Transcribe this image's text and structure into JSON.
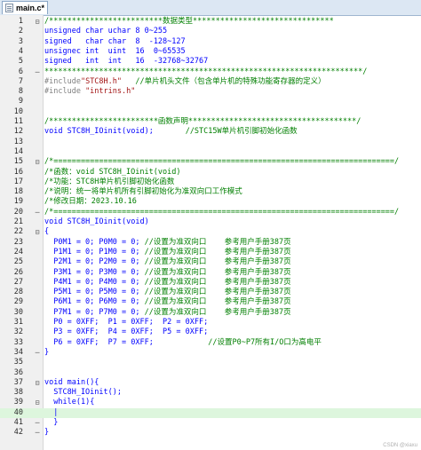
{
  "tab": {
    "title": "main.c*"
  },
  "watermark": "CSDN @xiaxu",
  "lines": [
    {
      "n": "1",
      "fold": "⊟",
      "segs": [
        [
          "cm",
          "/*************************数据类型*******************************"
        ]
      ]
    },
    {
      "n": "2",
      "fold": "",
      "segs": [
        [
          "txt",
          "unsigned char uchar 8 0~255"
        ]
      ]
    },
    {
      "n": "3",
      "fold": "",
      "segs": [
        [
          "txt",
          "signed   char char  8  -128~127"
        ]
      ]
    },
    {
      "n": "4",
      "fold": "",
      "segs": [
        [
          "txt",
          "unsignec int  uint  16  0~65535"
        ]
      ]
    },
    {
      "n": "5",
      "fold": "",
      "segs": [
        [
          "txt",
          "signed   int  int   16  -32768~32767"
        ]
      ]
    },
    {
      "n": "6",
      "fold": "─",
      "segs": [
        [
          "cm",
          "**********************************************************************/"
        ]
      ]
    },
    {
      "n": "7",
      "fold": "",
      "segs": [
        [
          "pp",
          "#include"
        ],
        [
          "str",
          "\"STC8H.h\""
        ],
        [
          "cm",
          "   //单片机头文件（包含单片机的特殊功能寄存器的定义）"
        ]
      ]
    },
    {
      "n": "8",
      "fold": "",
      "segs": [
        [
          "pp",
          "#include "
        ],
        [
          "str",
          "\"intrins.h\""
        ]
      ]
    },
    {
      "n": "9",
      "fold": "",
      "segs": []
    },
    {
      "n": "10",
      "fold": "",
      "segs": []
    },
    {
      "n": "11",
      "fold": "",
      "segs": [
        [
          "cm",
          "/************************函数声明*************************************/"
        ]
      ]
    },
    {
      "n": "12",
      "fold": "",
      "segs": [
        [
          "kw",
          "void"
        ],
        [
          "txt",
          " STC8H_IOinit("
        ],
        [
          "kw",
          "void"
        ],
        [
          "txt",
          ");"
        ],
        [
          "cm",
          "       //STC15W单片机引脚初始化函数"
        ]
      ]
    },
    {
      "n": "13",
      "fold": "",
      "segs": []
    },
    {
      "n": "14",
      "fold": "",
      "segs": []
    },
    {
      "n": "15",
      "fold": "⊟",
      "segs": [
        [
          "cm",
          "/*===========================================================================/"
        ]
      ]
    },
    {
      "n": "16",
      "fold": "",
      "segs": [
        [
          "cm",
          "/*函数：void STC8H_IOinit(void)"
        ]
      ]
    },
    {
      "n": "17",
      "fold": "",
      "segs": [
        [
          "cm",
          "/*功能：STC8H单片机引脚初始化函数"
        ]
      ]
    },
    {
      "n": "18",
      "fold": "",
      "segs": [
        [
          "cm",
          "/*说明：统一将单片机所有引脚初始化为准双向口工作模式"
        ]
      ]
    },
    {
      "n": "19",
      "fold": "",
      "segs": [
        [
          "cm",
          "/*修改日期：2023.10.16"
        ]
      ]
    },
    {
      "n": "20",
      "fold": "─",
      "segs": [
        [
          "cm",
          "/*===========================================================================/"
        ]
      ]
    },
    {
      "n": "21",
      "fold": "",
      "segs": [
        [
          "kw",
          "void"
        ],
        [
          "txt",
          " STC8H_IOinit("
        ],
        [
          "kw",
          "void"
        ],
        [
          "txt",
          ")"
        ]
      ]
    },
    {
      "n": "22",
      "fold": "⊟",
      "segs": [
        [
          "txt",
          "{"
        ]
      ]
    },
    {
      "n": "23",
      "fold": "",
      "segs": [
        [
          "txt",
          "  P0M1 = 0; P0M0 = 0; "
        ],
        [
          "cm",
          "//设置为准双向口    参考用户手册387页"
        ]
      ]
    },
    {
      "n": "24",
      "fold": "",
      "segs": [
        [
          "txt",
          "  P1M1 = 0; P1M0 = 0; "
        ],
        [
          "cm",
          "//设置为准双向口    参考用户手册387页"
        ]
      ]
    },
    {
      "n": "25",
      "fold": "",
      "segs": [
        [
          "txt",
          "  P2M1 = 0; P2M0 = 0; "
        ],
        [
          "cm",
          "//设置为准双向口    参考用户手册387页"
        ]
      ]
    },
    {
      "n": "26",
      "fold": "",
      "segs": [
        [
          "txt",
          "  P3M1 = 0; P3M0 = 0; "
        ],
        [
          "cm",
          "//设置为准双向口    参考用户手册387页"
        ]
      ]
    },
    {
      "n": "27",
      "fold": "",
      "segs": [
        [
          "txt",
          "  P4M1 = 0; P4M0 = 0; "
        ],
        [
          "cm",
          "//设置为准双向口    参考用户手册387页"
        ]
      ]
    },
    {
      "n": "28",
      "fold": "",
      "segs": [
        [
          "txt",
          "  P5M1 = 0; P5M0 = 0; "
        ],
        [
          "cm",
          "//设置为准双向口    参考用户手册387页"
        ]
      ]
    },
    {
      "n": "29",
      "fold": "",
      "segs": [
        [
          "txt",
          "  P6M1 = 0; P6M0 = 0; "
        ],
        [
          "cm",
          "//设置为准双向口    参考用户手册387页"
        ]
      ]
    },
    {
      "n": "30",
      "fold": "",
      "segs": [
        [
          "txt",
          "  P7M1 = 0; P7M0 = 0; "
        ],
        [
          "cm",
          "//设置为准双向口    参考用户手册387页"
        ]
      ]
    },
    {
      "n": "31",
      "fold": "",
      "segs": [
        [
          "txt",
          "  P0 = 0XFF;  P1 = 0XFF;  P2 = 0XFF;"
        ]
      ]
    },
    {
      "n": "32",
      "fold": "",
      "segs": [
        [
          "txt",
          "  P3 = 0XFF;  P4 = 0XFF;  P5 = 0XFF;"
        ]
      ]
    },
    {
      "n": "33",
      "fold": "",
      "segs": [
        [
          "txt",
          "  P6 = 0XFF;  P7 = 0XFF;            "
        ],
        [
          "cm",
          "//设置P0~P7所有I/O口为高电平"
        ]
      ]
    },
    {
      "n": "34",
      "fold": "─",
      "segs": [
        [
          "txt",
          "}"
        ]
      ]
    },
    {
      "n": "35",
      "fold": "",
      "segs": []
    },
    {
      "n": "36",
      "fold": "",
      "segs": []
    },
    {
      "n": "37",
      "fold": "⊟",
      "segs": [
        [
          "kw",
          "void"
        ],
        [
          "txt",
          " main(){"
        ]
      ]
    },
    {
      "n": "38",
      "fold": "",
      "segs": [
        [
          "txt",
          "  STC8H_IOinit();"
        ]
      ]
    },
    {
      "n": "39",
      "fold": "⊟",
      "segs": [
        [
          "txt",
          "  "
        ],
        [
          "kw",
          "while"
        ],
        [
          "txt",
          "("
        ],
        [
          "num",
          "1"
        ],
        [
          "txt",
          "){"
        ]
      ]
    },
    {
      "n": "40",
      "fold": "",
      "segs": [
        [
          "txt",
          "  |"
        ]
      ],
      "current": true
    },
    {
      "n": "41",
      "fold": "─",
      "segs": [
        [
          "txt",
          "  }"
        ]
      ]
    },
    {
      "n": "42",
      "fold": "─",
      "segs": [
        [
          "txt",
          "}"
        ]
      ]
    }
  ]
}
